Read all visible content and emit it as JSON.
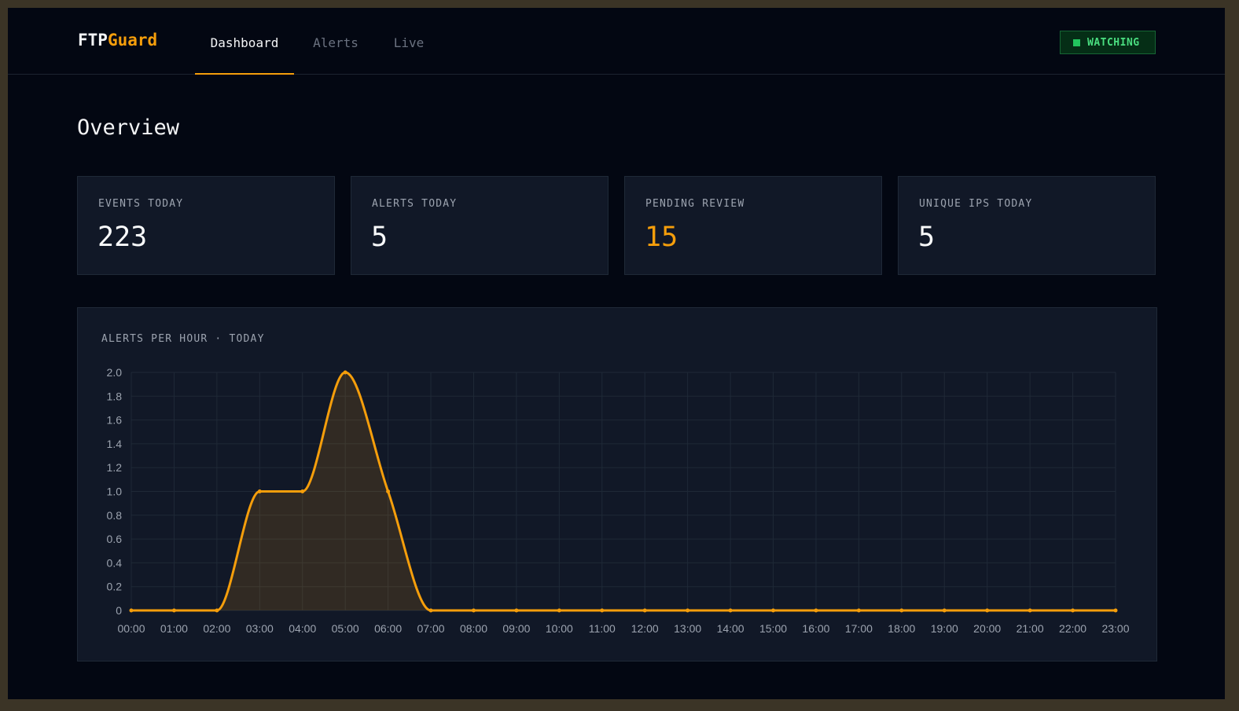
{
  "app": {
    "brand_part1": "FTP",
    "brand_part2": "Guard"
  },
  "nav": {
    "tabs": [
      {
        "label": "Dashboard",
        "active": true
      },
      {
        "label": "Alerts",
        "active": false
      },
      {
        "label": "Live",
        "active": false
      }
    ]
  },
  "status": {
    "label": "WATCHING",
    "color": "#22c55e"
  },
  "page": {
    "title": "Overview"
  },
  "stats": [
    {
      "label": "EVENTS TODAY",
      "value": "223"
    },
    {
      "label": "ALERTS TODAY",
      "value": "5"
    },
    {
      "label": "PENDING REVIEW",
      "value": "15",
      "color": "#f59e0b"
    },
    {
      "label": "UNIQUE IPS TODAY",
      "value": "5"
    }
  ],
  "chart_title": "ALERTS PER HOUR · TODAY",
  "chart_data": {
    "type": "area",
    "title": "ALERTS PER HOUR · TODAY",
    "xlabel": "",
    "ylabel": "",
    "x": [
      "00:00",
      "01:00",
      "02:00",
      "03:00",
      "04:00",
      "05:00",
      "06:00",
      "07:00",
      "08:00",
      "09:00",
      "10:00",
      "11:00",
      "12:00",
      "13:00",
      "14:00",
      "15:00",
      "16:00",
      "17:00",
      "18:00",
      "19:00",
      "20:00",
      "21:00",
      "22:00",
      "23:00"
    ],
    "values": [
      0,
      0,
      0,
      1,
      1,
      2,
      1,
      0,
      0,
      0,
      0,
      0,
      0,
      0,
      0,
      0,
      0,
      0,
      0,
      0,
      0,
      0,
      0,
      0
    ],
    "ylim": [
      0,
      2
    ],
    "yticks": [
      "0",
      "0.2",
      "0.4",
      "0.6",
      "0.8",
      "1.0",
      "1.2",
      "1.4",
      "1.6",
      "1.8",
      "2.0"
    ],
    "grid": true,
    "legend": "none",
    "line_color": "#f59e0b"
  }
}
